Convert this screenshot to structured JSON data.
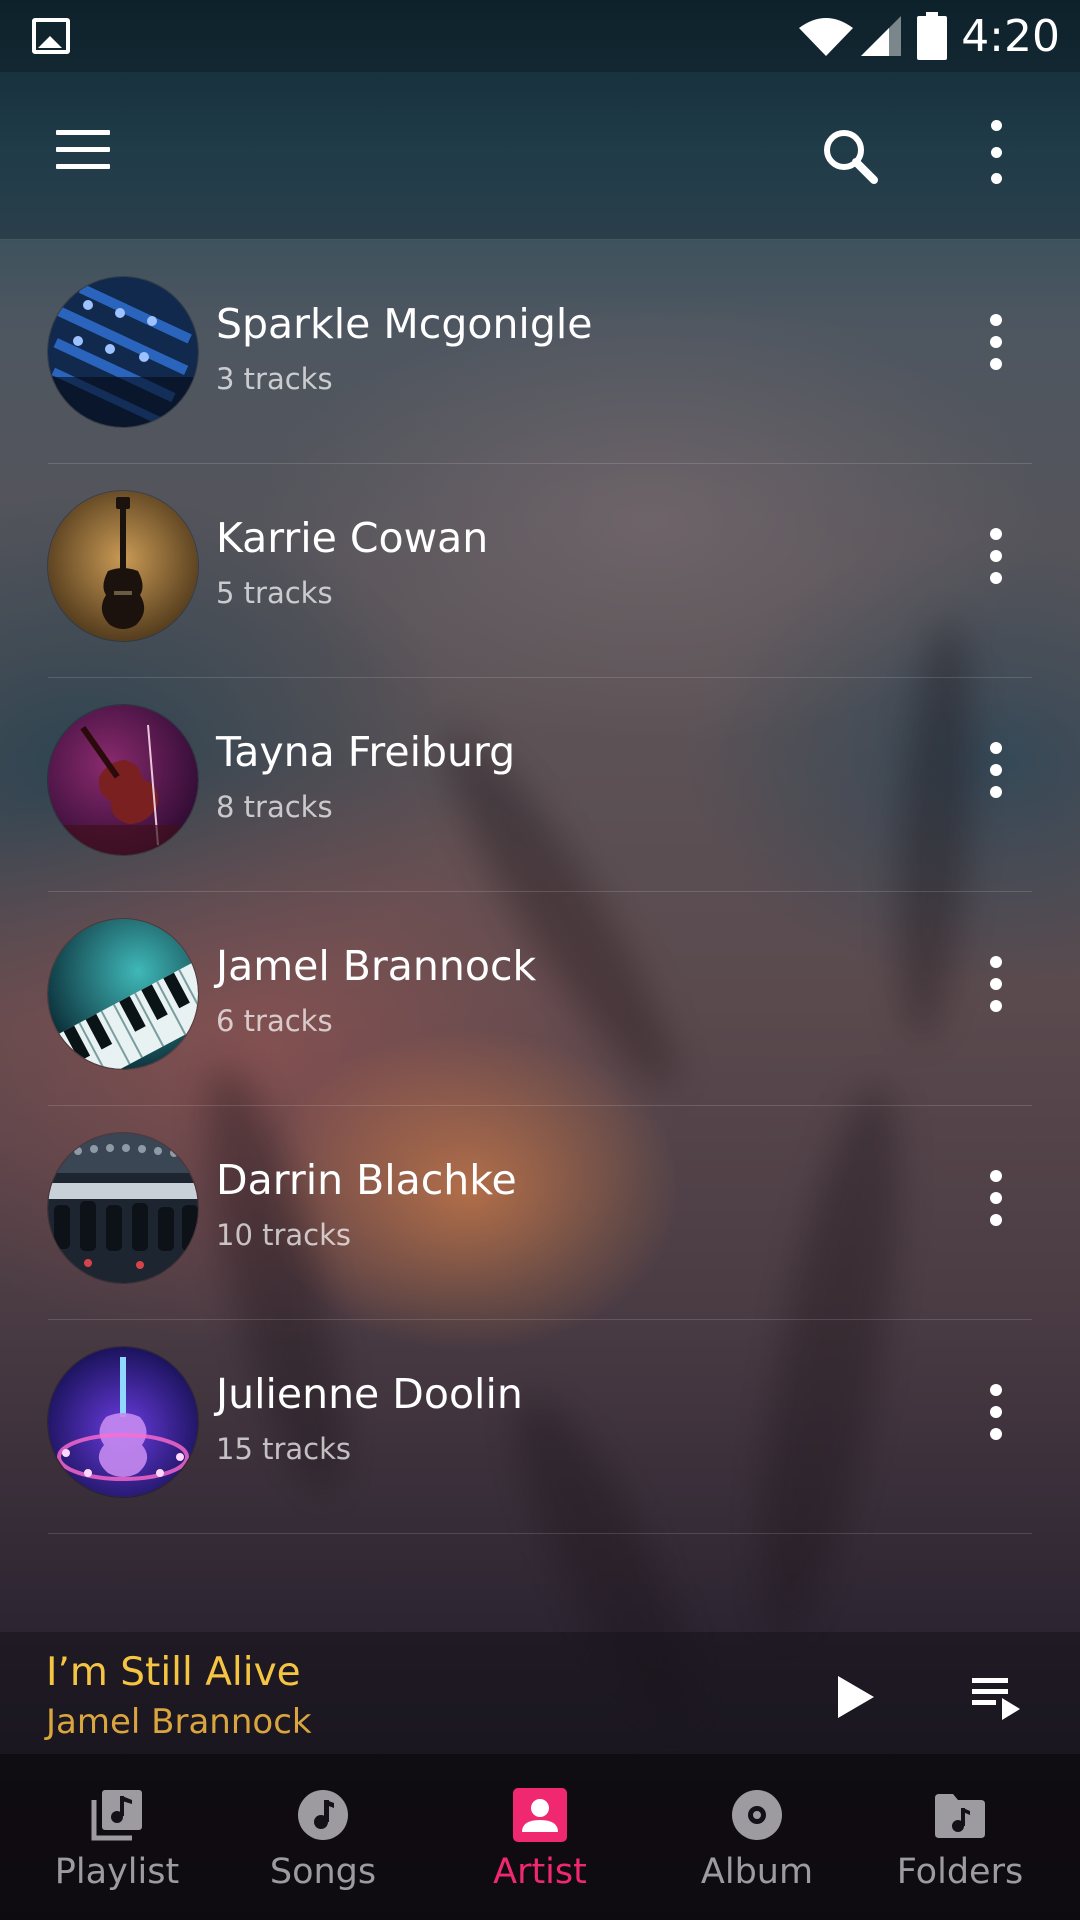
{
  "status_bar": {
    "time": "4:20",
    "icons": [
      "image-notification-icon",
      "wifi-icon",
      "signal-icon",
      "battery-icon"
    ]
  },
  "toolbar": {
    "icons": [
      "hamburger-menu-icon",
      "search-icon",
      "more-vert-icon"
    ]
  },
  "artists": [
    {
      "name": "Sparkle Mcgonigle",
      "tracks": "3 tracks",
      "thumb": "mixing-console"
    },
    {
      "name": "Karrie Cowan",
      "tracks": "5 tracks",
      "thumb": "electric-guitar"
    },
    {
      "name": "Tayna Freiburg",
      "tracks": "8 tracks",
      "thumb": "violin"
    },
    {
      "name": "Jamel Brannock",
      "tracks": "6 tracks",
      "thumb": "piano-keys"
    },
    {
      "name": "Darrin Blachke",
      "tracks": "10 tracks",
      "thumb": "mixer-knobs"
    },
    {
      "name": "Julienne Doolin",
      "tracks": "15 tracks",
      "thumb": "neon-guitar"
    }
  ],
  "now_playing": {
    "title": "I’m Still Alive",
    "artist": "Jamel Brannock",
    "icons": [
      "play-icon",
      "queue-icon"
    ]
  },
  "bottom_nav": {
    "tabs": [
      {
        "label": "Playlist",
        "icon": "playlist-icon"
      },
      {
        "label": "Songs",
        "icon": "music-note-icon"
      },
      {
        "label": "Artist",
        "icon": "artist-icon"
      },
      {
        "label": "Album",
        "icon": "album-icon"
      },
      {
        "label": "Folders",
        "icon": "folder-music-icon"
      }
    ],
    "active": "Artist"
  },
  "colors": {
    "accent": "#f0286f",
    "now_playing_title": "#f5c542",
    "now_playing_artist": "#d9a53e",
    "inactive_nav": "#9d9aa0"
  }
}
